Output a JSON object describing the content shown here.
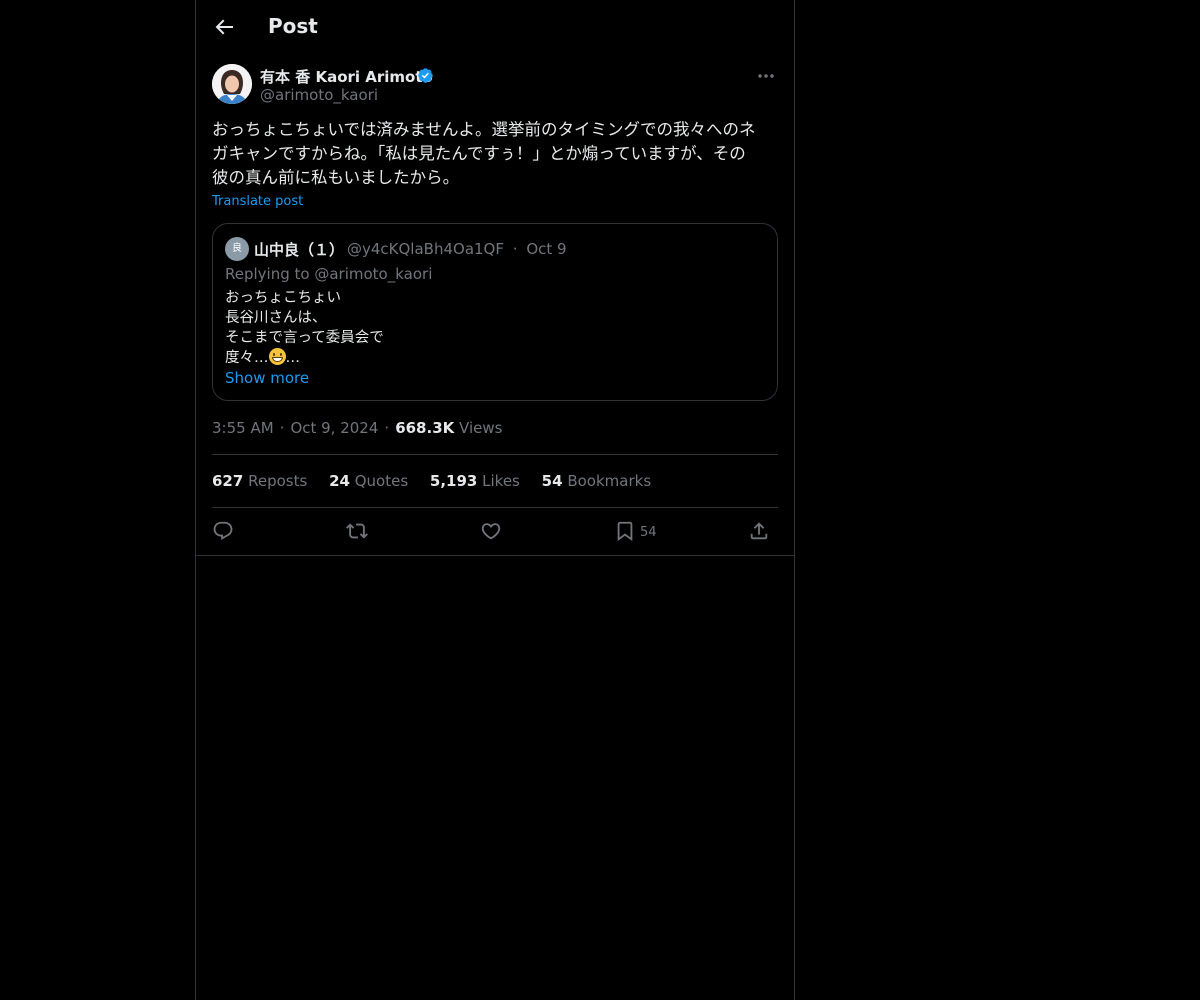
{
  "header": {
    "title": "Post"
  },
  "author": {
    "display_name": "有本 香 Kaori Arimoto",
    "handle": "@arimoto_kaori",
    "verified": true
  },
  "post": {
    "text_lines": [
      "おっちょこちょいでは済みませんよ。選挙前のタイミングでの我々へのネ",
      "ガキャンですからね。「私は見たんですぅ！」とか煽っていますが、その",
      "彼の真ん前に私もいましたから。"
    ],
    "translate_label": "Translate post"
  },
  "quote": {
    "avatar_initial": "良",
    "name": "山中良（１）",
    "handle": "@y4cKQlaBh4Oa1QF",
    "separator": "·",
    "date": "Oct 9",
    "replying_prefix": "Replying to",
    "replying_to": "@arimoto_kaori",
    "body_lines": [
      "おっちょこちょい",
      "長谷川さんは、",
      "そこまで言って委員会で",
      "度々…"
    ],
    "trailing_ellipsis": "…",
    "emoji": "grinning-face-emoji",
    "show_more": "Show more"
  },
  "meta": {
    "time": "3:55 AM",
    "date": "Oct 9, 2024",
    "separator": "·",
    "views_count": "668.3K",
    "views_label": "Views"
  },
  "stats": {
    "reposts_count": "627",
    "reposts_label": "Reposts",
    "quotes_count": "24",
    "quotes_label": "Quotes",
    "likes_count": "5,193",
    "likes_label": "Likes",
    "bookmarks_count": "54",
    "bookmarks_label": "Bookmarks"
  },
  "actions": {
    "bookmark_count": "54",
    "icons": [
      "reply-icon",
      "repost-icon",
      "like-icon",
      "bookmark-icon",
      "share-icon"
    ]
  },
  "colors": {
    "background": "#000000",
    "text": "#e7e9ea",
    "muted": "#71767b",
    "accent": "#1d9bf0",
    "border": "#2f3336"
  }
}
